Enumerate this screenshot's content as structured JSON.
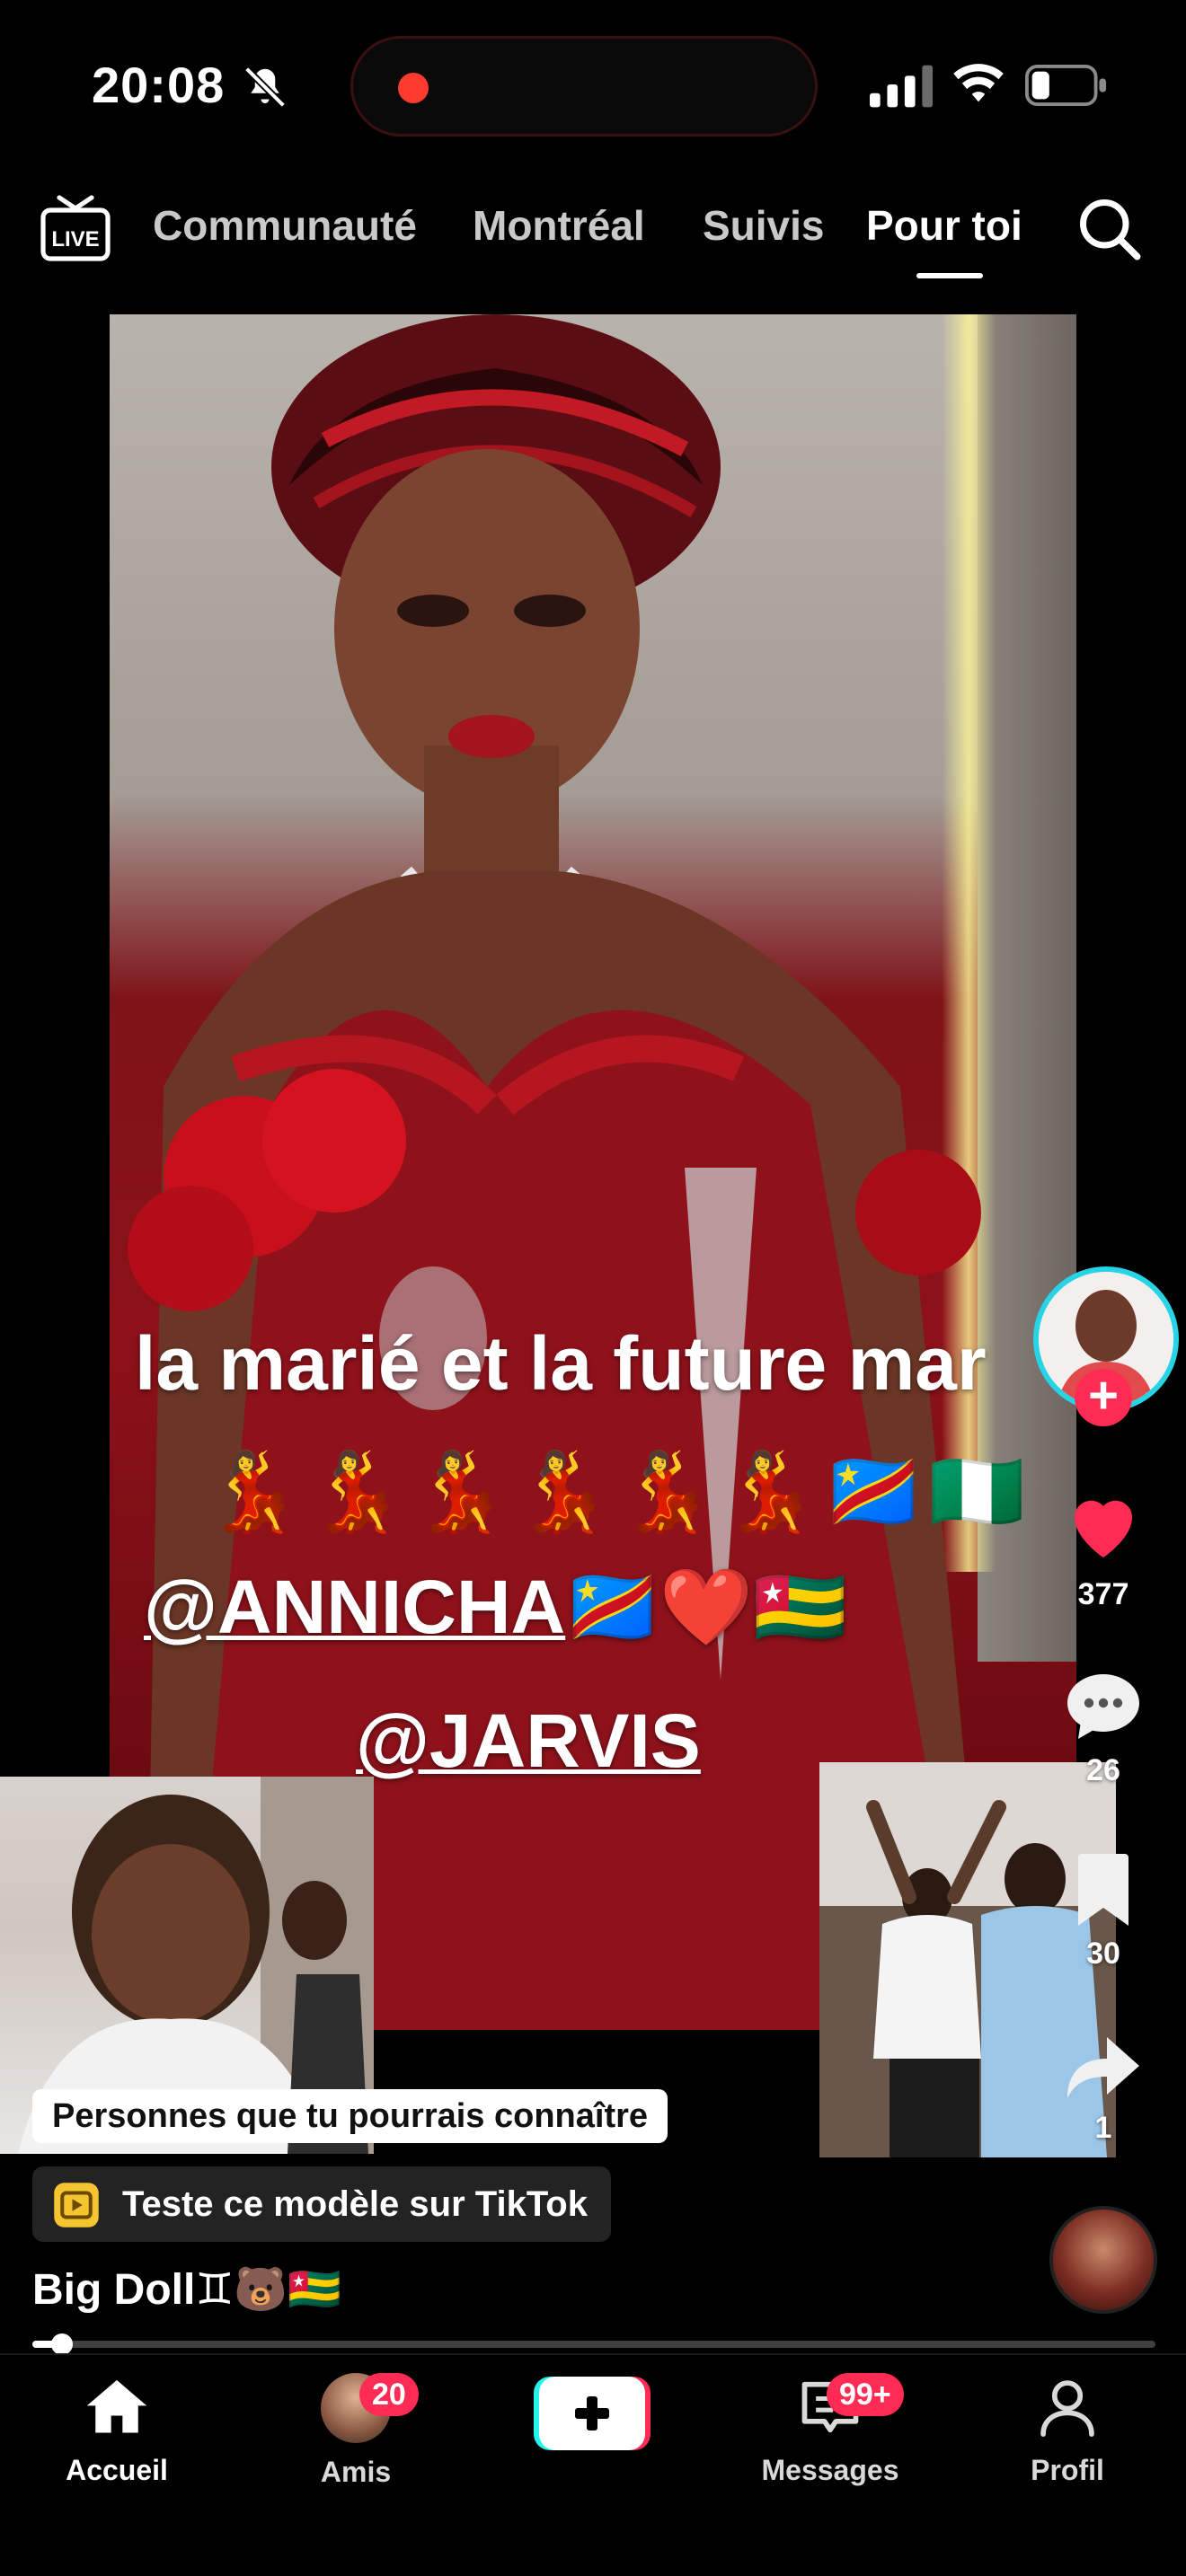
{
  "status_bar": {
    "time": "20:08",
    "icons": [
      "bell-slash-icon",
      "recording-dot-icon",
      "signal-icon",
      "wifi-icon",
      "battery-icon"
    ]
  },
  "top_nav": {
    "live_label": "LIVE",
    "tabs": [
      {
        "label": "Communauté",
        "active": false
      },
      {
        "label": "Montréal",
        "active": false
      },
      {
        "label": "Suivis",
        "active": false
      },
      {
        "label": "Pour toi",
        "active": true
      }
    ]
  },
  "video": {
    "caption_line1": "la marié et la future mar",
    "emoji_line": "💃💃💃💃💃💃🇨🇩🇳🇬",
    "mention_1": "@ANNICHA",
    "mention_1_emojis": "🇨🇩❤️🇹🇬",
    "mention_2": "@JARVIS"
  },
  "actions": {
    "likes": "377",
    "comments": "26",
    "saves": "30",
    "shares": "1"
  },
  "overlay": {
    "people_chip": "Personnes que tu pourrais connaître",
    "template_chip": "Teste ce modèle sur TikTok",
    "username": "Big Doll♊🐻🇹🇬",
    "progress": 0.02
  },
  "bottom_nav": {
    "items": [
      {
        "label": "Accueil",
        "active": true
      },
      {
        "label": "Amis",
        "badge": "20"
      },
      {
        "label": ""
      },
      {
        "label": "Messages",
        "badge": "99+"
      },
      {
        "label": "Profil"
      }
    ]
  },
  "colors": {
    "accent": "#fe2c55",
    "cyan": "#25f4ee",
    "background": "#000000"
  }
}
